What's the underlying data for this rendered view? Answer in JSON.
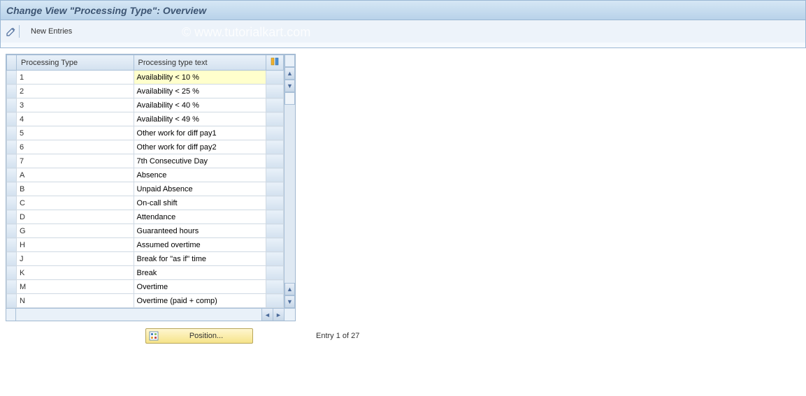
{
  "title": "Change View \"Processing Type\": Overview",
  "toolbar": {
    "new_entries_label": "New Entries"
  },
  "columns": {
    "code": "Processing Type",
    "text": "Processing type text"
  },
  "rows": [
    {
      "code": "1",
      "text": "Availability < 10 %"
    },
    {
      "code": "2",
      "text": "Availability < 25 %"
    },
    {
      "code": "3",
      "text": "Availability < 40 %"
    },
    {
      "code": "4",
      "text": "Availability < 49 %"
    },
    {
      "code": "5",
      "text": "Other work for diff pay1"
    },
    {
      "code": "6",
      "text": "Other work for diff pay2"
    },
    {
      "code": "7",
      "text": "7th Consecutive Day"
    },
    {
      "code": "A",
      "text": "Absence"
    },
    {
      "code": "B",
      "text": "Unpaid Absence"
    },
    {
      "code": "C",
      "text": "On-call shift"
    },
    {
      "code": "D",
      "text": "Attendance"
    },
    {
      "code": "G",
      "text": "Guaranteed hours"
    },
    {
      "code": "H",
      "text": "Assumed overtime"
    },
    {
      "code": "J",
      "text": "Break for \"as if\" time"
    },
    {
      "code": "K",
      "text": "Break"
    },
    {
      "code": "M",
      "text": "Overtime"
    },
    {
      "code": "N",
      "text": "Overtime (paid + comp)"
    }
  ],
  "footer": {
    "position_label": "Position...",
    "entry_text": "Entry 1 of 27"
  },
  "watermark": "© www.tutorialkart.com"
}
